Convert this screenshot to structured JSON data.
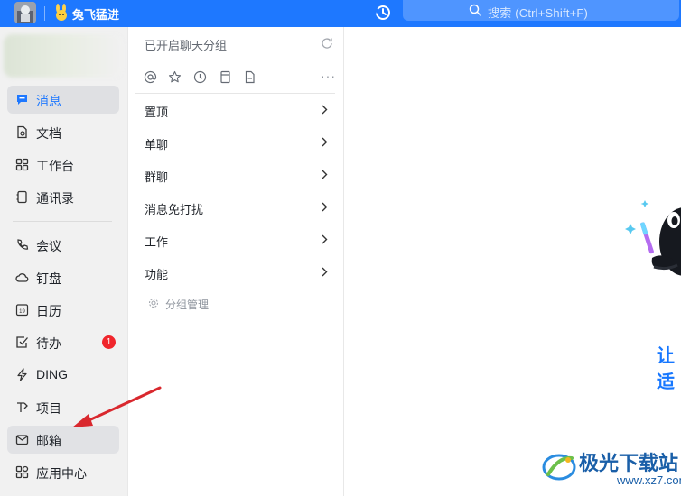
{
  "topbar": {
    "org_name": "兔飞猛进",
    "search_placeholder": "搜索 (Ctrl+Shift+F)",
    "accent": "#1e78ff",
    "icons": [
      "avatar",
      "org-logo-icon",
      "history-icon",
      "search-icon"
    ]
  },
  "nav": {
    "items": [
      {
        "label": "消息",
        "icon": "message-icon",
        "active": true
      },
      {
        "label": "文档",
        "icon": "document-icon"
      },
      {
        "label": "工作台",
        "icon": "grid-icon"
      },
      {
        "label": "通讯录",
        "icon": "contacts-icon"
      },
      {
        "label": "会议",
        "icon": "phone-icon"
      },
      {
        "label": "钉盘",
        "icon": "cloud-icon"
      },
      {
        "label": "日历",
        "icon": "calendar-icon",
        "calendar_day": "19"
      },
      {
        "label": "待办",
        "icon": "checkbox-icon",
        "badge": "1"
      },
      {
        "label": "DING",
        "icon": "lightning-icon"
      },
      {
        "label": "项目",
        "icon": "project-icon"
      },
      {
        "label": "邮箱",
        "icon": "mail-icon",
        "hover": true
      },
      {
        "label": "应用中心",
        "icon": "apps-icon"
      }
    ]
  },
  "middle": {
    "title": "已开启聊天分组",
    "quick_icons": [
      "at-icon",
      "star-icon",
      "clock-icon",
      "archive-icon",
      "file-icon"
    ],
    "more": "···",
    "groups": [
      "置顶",
      "单聊",
      "群聊",
      "消息免打扰",
      "工作",
      "功能"
    ],
    "manage_label": "分组管理"
  },
  "right": {
    "welcome_fragment": "让适",
    "watermark": {
      "title": "极光下载站",
      "subtitle": "www.xz7.com"
    }
  },
  "colors": {
    "badge": "#f0262c",
    "active_text": "#1e78ff",
    "arrow": "#d9282e"
  }
}
